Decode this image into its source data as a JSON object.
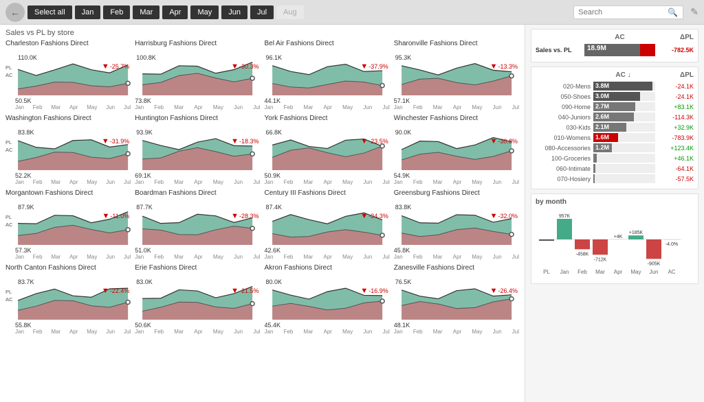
{
  "topbar": {
    "back_label": "←",
    "select_all": "Select all",
    "months": [
      "Jan",
      "Feb",
      "Mar",
      "Apr",
      "May",
      "Jun",
      "Jul",
      "Aug"
    ],
    "active_months": [
      "Jan",
      "Feb",
      "Mar",
      "Apr",
      "May",
      "Jun",
      "Jul"
    ],
    "search_placeholder": "Search",
    "filter_icon": "🖉"
  },
  "section_title": "Sales vs PL by store",
  "stores": [
    {
      "name": "Charleston Fashions Direct",
      "top_val": "110.0K",
      "bottom_val": "50.5K",
      "delta": "-25.7%",
      "pl_label": "PL",
      "ac_label": "AC"
    },
    {
      "name": "Harrisburg Fashions Direct",
      "top_val": "100.8K",
      "bottom_val": "73.8K",
      "delta": "-30.3%",
      "pl_label": "",
      "ac_label": ""
    },
    {
      "name": "Bel Air Fashions Direct",
      "top_val": "96.1K",
      "bottom_val": "44.1K",
      "delta": "-37.9%",
      "pl_label": "",
      "ac_label": ""
    },
    {
      "name": "Sharonville Fashions Direct",
      "top_val": "95.3K",
      "bottom_val": "57.1K",
      "delta": "-13.3%",
      "pl_label": "",
      "ac_label": ""
    },
    {
      "name": "Washington Fashions Direct",
      "top_val": "83.8K",
      "bottom_val": "52.2K",
      "delta": "-31.9%",
      "pl_label": "PL",
      "ac_label": "AC"
    },
    {
      "name": "Huntington Fashions Direct",
      "top_val": "93.9K",
      "bottom_val": "69.1K",
      "delta": "-18.3%",
      "pl_label": "",
      "ac_label": ""
    },
    {
      "name": "York Fashions Direct",
      "top_val": "66.8K",
      "bottom_val": "50.9K",
      "delta": "-23.5%",
      "pl_label": "",
      "ac_label": ""
    },
    {
      "name": "Winchester Fashions Direct",
      "top_val": "90.0K",
      "bottom_val": "54.9K",
      "delta": "-30.8%",
      "pl_label": "",
      "ac_label": ""
    },
    {
      "name": "Morgantown Fashions Direct",
      "top_val": "87.9K",
      "bottom_val": "57.3K",
      "delta": "-11.0%",
      "pl_label": "PL",
      "ac_label": "AC"
    },
    {
      "name": "Boardman Fashions Direct",
      "top_val": "87.7K",
      "bottom_val": "51.0K",
      "delta": "-28.3%",
      "pl_label": "",
      "ac_label": ""
    },
    {
      "name": "Century III Fashions Direct",
      "top_val": "87.4K",
      "bottom_val": "42.6K",
      "delta": "-34.3%",
      "pl_label": "",
      "ac_label": ""
    },
    {
      "name": "Greensburg Fashions Direct",
      "top_val": "83.8K",
      "bottom_val": "45.8K",
      "delta": "-32.0%",
      "pl_label": "",
      "ac_label": ""
    },
    {
      "name": "North Canton Fashions Direct",
      "top_val": "83.7K",
      "bottom_val": "55.8K",
      "delta": "-22.4%",
      "pl_label": "PL",
      "ac_label": "AC"
    },
    {
      "name": "Erie Fashions Direct",
      "top_val": "83.0K",
      "bottom_val": "50.6K",
      "delta": "-21.5%",
      "pl_label": "",
      "ac_label": ""
    },
    {
      "name": "Akron Fashions Direct",
      "top_val": "80.0K",
      "bottom_val": "45.4K",
      "delta": "-16.9%",
      "pl_label": "",
      "ac_label": ""
    },
    {
      "name": "Zanesville Fashions Direct",
      "top_val": "76.5K",
      "bottom_val": "48.1K",
      "delta": "-26.4%",
      "pl_label": "",
      "ac_label": ""
    }
  ],
  "right": {
    "sales_section": {
      "header_ac": "AC",
      "header_dpl": "ΔPL",
      "sales_label": "Sales vs. PL",
      "sales_ac": "18.9M",
      "sales_delta": "-782.5K"
    },
    "categories_header_ac": "AC ↓",
    "categories_header_dpl": "ΔPL",
    "categories": [
      {
        "label": "020-Mens",
        "ac": "3.8M",
        "ac_pct": 95,
        "delta": "-24.1K",
        "delta_sign": "neg"
      },
      {
        "label": "050-Shoes",
        "ac": "3.0M",
        "ac_pct": 75,
        "delta": "-24.1K",
        "delta_sign": "neg"
      },
      {
        "label": "090-Home",
        "ac": "2.7M",
        "ac_pct": 68,
        "delta": "+83.1K",
        "delta_sign": "pos"
      },
      {
        "label": "040-Juniors",
        "ac": "2.6M",
        "ac_pct": 65,
        "delta": "-114.3K",
        "delta_sign": "neg"
      },
      {
        "label": "030-Kids",
        "ac": "2.1M",
        "ac_pct": 53,
        "delta": "+32.9K",
        "delta_sign": "pos"
      },
      {
        "label": "010-Womens",
        "ac": "1.6M",
        "ac_pct": 40,
        "delta": "-783.9K",
        "delta_sign": "neg",
        "highlight": true
      },
      {
        "label": "080-Accessories",
        "ac": "1.2M",
        "ac_pct": 30,
        "delta": "+123.4K",
        "delta_sign": "pos"
      },
      {
        "label": "100-Groceries",
        "ac": "",
        "ac_pct": 5,
        "delta": "+46.1K",
        "delta_sign": "pos"
      },
      {
        "label": "060-Intimate",
        "ac": "",
        "ac_pct": 3,
        "delta": "-64.1K",
        "delta_sign": "neg"
      },
      {
        "label": "070-Hosiery",
        "ac": "",
        "ac_pct": 2,
        "delta": "-57.5K",
        "delta_sign": "neg"
      }
    ],
    "by_month": {
      "title": "by month",
      "labels": [
        "PL",
        "Jan",
        "Feb",
        "Mar",
        "Apr",
        "May",
        "Jun",
        "AC"
      ],
      "values": [
        0,
        957,
        -458,
        -712,
        4,
        185,
        -905,
        -4
      ],
      "display_vals": [
        "",
        "957K",
        "-458K",
        "-712K",
        "+4K",
        "+185K",
        "-905K",
        "-4.0%"
      ]
    }
  }
}
